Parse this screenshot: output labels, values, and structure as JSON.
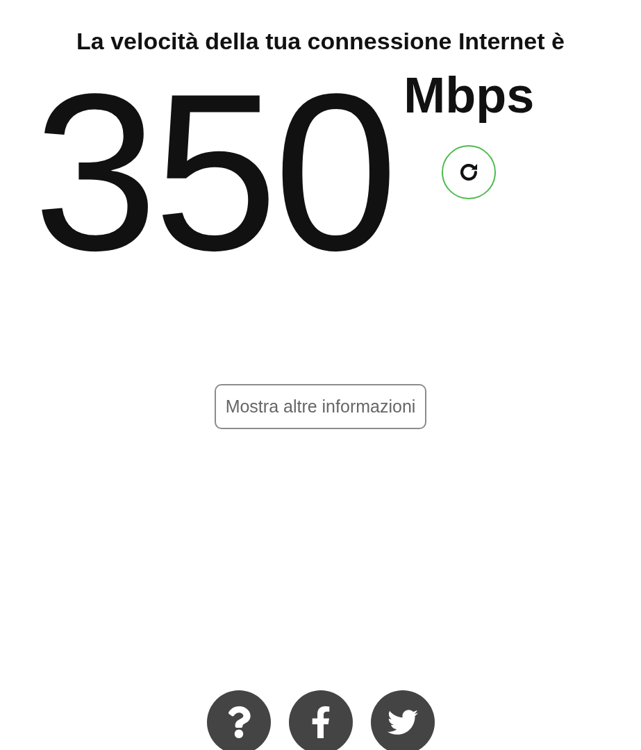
{
  "heading": "La velocità della tua connessione Internet è",
  "speed": {
    "value": "350",
    "unit": "Mbps"
  },
  "more_info_button": {
    "label": "Mostra altre informazioni"
  }
}
